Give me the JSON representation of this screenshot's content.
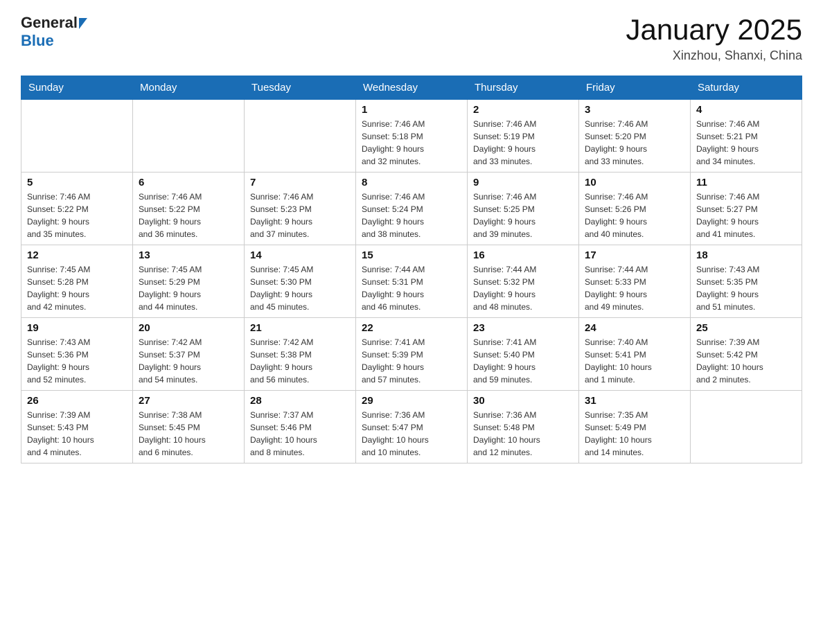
{
  "header": {
    "logo": {
      "general": "General",
      "blue": "Blue",
      "arrow_alt": "blue arrow"
    },
    "title": "January 2025",
    "location": "Xinzhou, Shanxi, China"
  },
  "calendar": {
    "days_of_week": [
      "Sunday",
      "Monday",
      "Tuesday",
      "Wednesday",
      "Thursday",
      "Friday",
      "Saturday"
    ],
    "weeks": [
      [
        {
          "day": "",
          "info": ""
        },
        {
          "day": "",
          "info": ""
        },
        {
          "day": "",
          "info": ""
        },
        {
          "day": "1",
          "info": "Sunrise: 7:46 AM\nSunset: 5:18 PM\nDaylight: 9 hours\nand 32 minutes."
        },
        {
          "day": "2",
          "info": "Sunrise: 7:46 AM\nSunset: 5:19 PM\nDaylight: 9 hours\nand 33 minutes."
        },
        {
          "day": "3",
          "info": "Sunrise: 7:46 AM\nSunset: 5:20 PM\nDaylight: 9 hours\nand 33 minutes."
        },
        {
          "day": "4",
          "info": "Sunrise: 7:46 AM\nSunset: 5:21 PM\nDaylight: 9 hours\nand 34 minutes."
        }
      ],
      [
        {
          "day": "5",
          "info": "Sunrise: 7:46 AM\nSunset: 5:22 PM\nDaylight: 9 hours\nand 35 minutes."
        },
        {
          "day": "6",
          "info": "Sunrise: 7:46 AM\nSunset: 5:22 PM\nDaylight: 9 hours\nand 36 minutes."
        },
        {
          "day": "7",
          "info": "Sunrise: 7:46 AM\nSunset: 5:23 PM\nDaylight: 9 hours\nand 37 minutes."
        },
        {
          "day": "8",
          "info": "Sunrise: 7:46 AM\nSunset: 5:24 PM\nDaylight: 9 hours\nand 38 minutes."
        },
        {
          "day": "9",
          "info": "Sunrise: 7:46 AM\nSunset: 5:25 PM\nDaylight: 9 hours\nand 39 minutes."
        },
        {
          "day": "10",
          "info": "Sunrise: 7:46 AM\nSunset: 5:26 PM\nDaylight: 9 hours\nand 40 minutes."
        },
        {
          "day": "11",
          "info": "Sunrise: 7:46 AM\nSunset: 5:27 PM\nDaylight: 9 hours\nand 41 minutes."
        }
      ],
      [
        {
          "day": "12",
          "info": "Sunrise: 7:45 AM\nSunset: 5:28 PM\nDaylight: 9 hours\nand 42 minutes."
        },
        {
          "day": "13",
          "info": "Sunrise: 7:45 AM\nSunset: 5:29 PM\nDaylight: 9 hours\nand 44 minutes."
        },
        {
          "day": "14",
          "info": "Sunrise: 7:45 AM\nSunset: 5:30 PM\nDaylight: 9 hours\nand 45 minutes."
        },
        {
          "day": "15",
          "info": "Sunrise: 7:44 AM\nSunset: 5:31 PM\nDaylight: 9 hours\nand 46 minutes."
        },
        {
          "day": "16",
          "info": "Sunrise: 7:44 AM\nSunset: 5:32 PM\nDaylight: 9 hours\nand 48 minutes."
        },
        {
          "day": "17",
          "info": "Sunrise: 7:44 AM\nSunset: 5:33 PM\nDaylight: 9 hours\nand 49 minutes."
        },
        {
          "day": "18",
          "info": "Sunrise: 7:43 AM\nSunset: 5:35 PM\nDaylight: 9 hours\nand 51 minutes."
        }
      ],
      [
        {
          "day": "19",
          "info": "Sunrise: 7:43 AM\nSunset: 5:36 PM\nDaylight: 9 hours\nand 52 minutes."
        },
        {
          "day": "20",
          "info": "Sunrise: 7:42 AM\nSunset: 5:37 PM\nDaylight: 9 hours\nand 54 minutes."
        },
        {
          "day": "21",
          "info": "Sunrise: 7:42 AM\nSunset: 5:38 PM\nDaylight: 9 hours\nand 56 minutes."
        },
        {
          "day": "22",
          "info": "Sunrise: 7:41 AM\nSunset: 5:39 PM\nDaylight: 9 hours\nand 57 minutes."
        },
        {
          "day": "23",
          "info": "Sunrise: 7:41 AM\nSunset: 5:40 PM\nDaylight: 9 hours\nand 59 minutes."
        },
        {
          "day": "24",
          "info": "Sunrise: 7:40 AM\nSunset: 5:41 PM\nDaylight: 10 hours\nand 1 minute."
        },
        {
          "day": "25",
          "info": "Sunrise: 7:39 AM\nSunset: 5:42 PM\nDaylight: 10 hours\nand 2 minutes."
        }
      ],
      [
        {
          "day": "26",
          "info": "Sunrise: 7:39 AM\nSunset: 5:43 PM\nDaylight: 10 hours\nand 4 minutes."
        },
        {
          "day": "27",
          "info": "Sunrise: 7:38 AM\nSunset: 5:45 PM\nDaylight: 10 hours\nand 6 minutes."
        },
        {
          "day": "28",
          "info": "Sunrise: 7:37 AM\nSunset: 5:46 PM\nDaylight: 10 hours\nand 8 minutes."
        },
        {
          "day": "29",
          "info": "Sunrise: 7:36 AM\nSunset: 5:47 PM\nDaylight: 10 hours\nand 10 minutes."
        },
        {
          "day": "30",
          "info": "Sunrise: 7:36 AM\nSunset: 5:48 PM\nDaylight: 10 hours\nand 12 minutes."
        },
        {
          "day": "31",
          "info": "Sunrise: 7:35 AM\nSunset: 5:49 PM\nDaylight: 10 hours\nand 14 minutes."
        },
        {
          "day": "",
          "info": ""
        }
      ]
    ]
  }
}
